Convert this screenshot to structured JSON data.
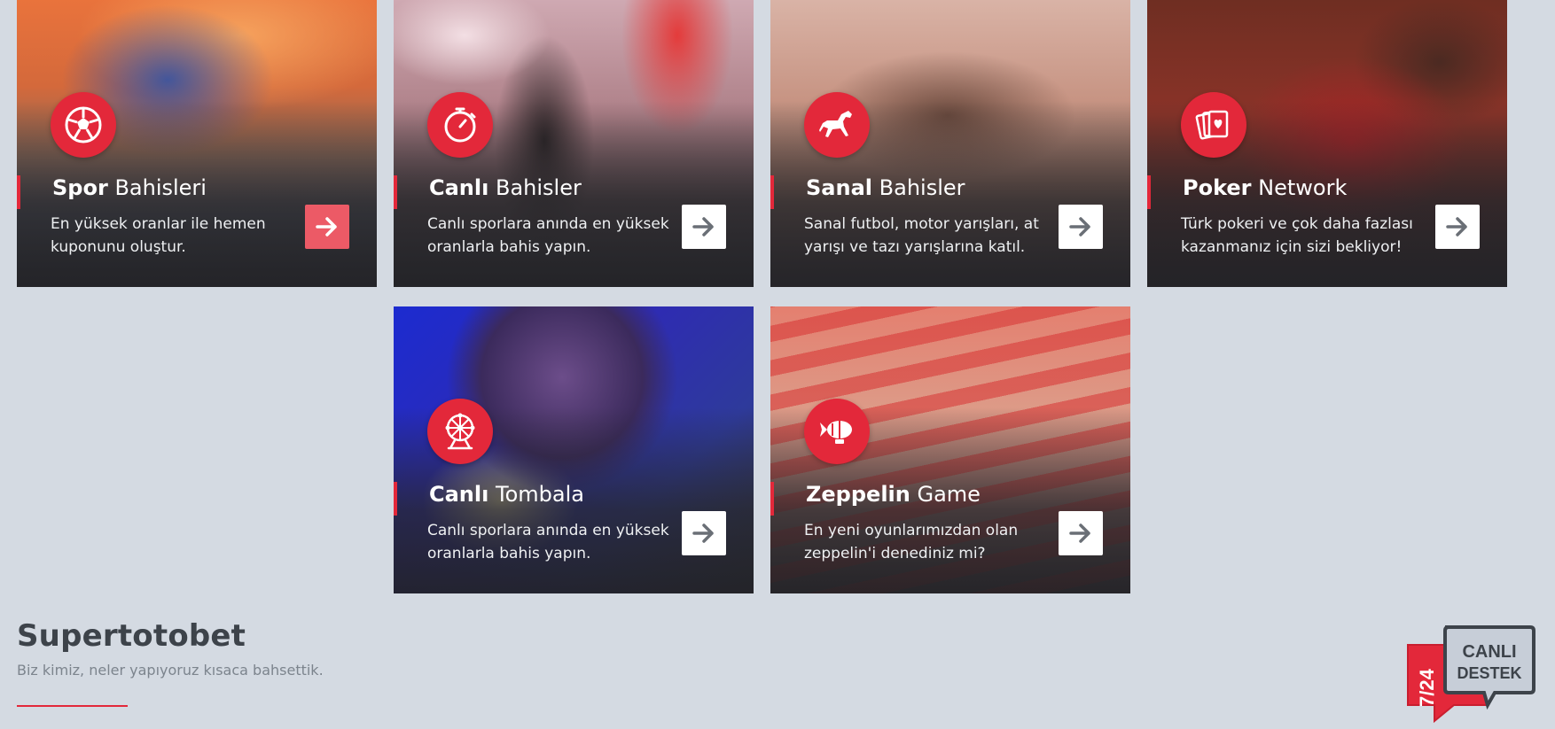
{
  "cards": [
    {
      "bold": "Spor",
      "light": "Bahisleri",
      "desc": "En yüksek oranlar ile hemen kuponunu oluştur.",
      "icon": "soccer-ball-icon"
    },
    {
      "bold": "Canlı",
      "light": "Bahisler",
      "desc": "Canlı sporlara anında en yüksek oranlarla bahis yapın.",
      "icon": "stopwatch-icon"
    },
    {
      "bold": "Sanal",
      "light": "Bahisler",
      "desc": "Sanal futbol, motor yarışları, at yarışı ve tazı yarışlarına katıl.",
      "icon": "horse-icon"
    },
    {
      "bold": "Poker",
      "light": "Network",
      "desc": "Türk pokeri ve çok daha fazlası kazanmanız için sizi bekliyor!",
      "icon": "playing-cards-icon"
    },
    {
      "bold": "Canlı",
      "light": "Tombala",
      "desc": "Canlı sporlara anında en yüksek oranlarla bahis yapın.",
      "icon": "ferris-wheel-icon"
    },
    {
      "bold": "Zeppelin",
      "light": "Game",
      "desc": "En yeni oyunlarımızdan olan zeppelin'i denediniz mi?",
      "icon": "zeppelin-icon"
    }
  ],
  "section": {
    "title": "Supertotobet",
    "subtitle": "Biz kimiz, neler yapıyoruz kısaca bahsettik."
  },
  "support_badge": {
    "hours": "7/24",
    "line1": "CANLI",
    "line2": "DESTEK"
  },
  "colors": {
    "accent": "#e3283a",
    "background": "#d4dae2",
    "text_dark": "#3d434a"
  }
}
